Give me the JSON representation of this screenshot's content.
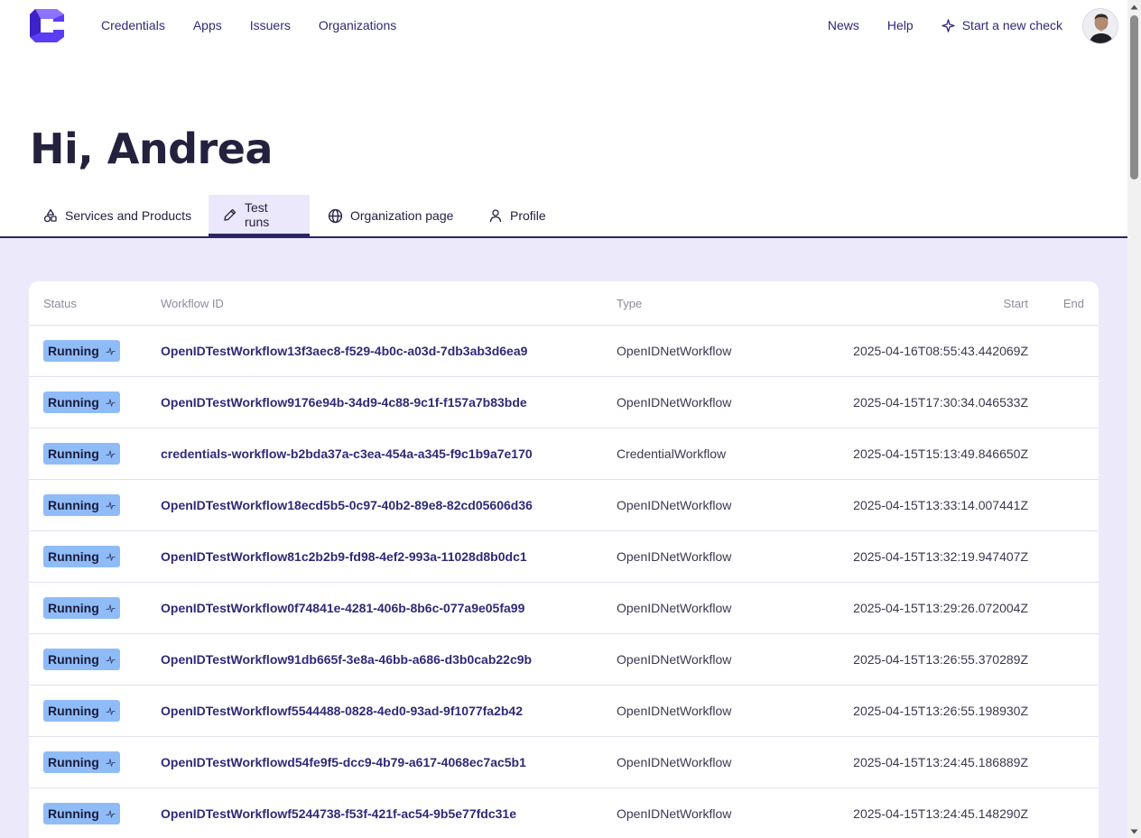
{
  "nav": {
    "links": [
      "Credentials",
      "Apps",
      "Issuers",
      "Organizations"
    ],
    "news": "News",
    "help": "Help",
    "start_check": "Start a new check"
  },
  "greeting": "Hi, Andrea",
  "tabs": [
    {
      "label": "Services and Products",
      "icon": "shapes-icon",
      "active": false
    },
    {
      "label": "Test runs",
      "icon": "pencil-icon",
      "active": true
    },
    {
      "label": "Organization page",
      "icon": "globe-icon",
      "active": false
    },
    {
      "label": "Profile",
      "icon": "user-icon",
      "active": false
    }
  ],
  "table": {
    "headers": {
      "status": "Status",
      "workflow_id": "Workflow ID",
      "type": "Type",
      "start": "Start",
      "end": "End"
    },
    "rows": [
      {
        "status": "Running",
        "id": "OpenIDTestWorkflow13f3aec8-f529-4b0c-a03d-7db3ab3d6ea9",
        "type": "OpenIDNetWorkflow",
        "start": "2025-04-16T08:55:43.442069Z",
        "end": ""
      },
      {
        "status": "Running",
        "id": "OpenIDTestWorkflow9176e94b-34d9-4c88-9c1f-f157a7b83bde",
        "type": "OpenIDNetWorkflow",
        "start": "2025-04-15T17:30:34.046533Z",
        "end": ""
      },
      {
        "status": "Running",
        "id": "credentials-workflow-b2bda37a-c3ea-454a-a345-f9c1b9a7e170",
        "type": "CredentialWorkflow",
        "start": "2025-04-15T15:13:49.846650Z",
        "end": ""
      },
      {
        "status": "Running",
        "id": "OpenIDTestWorkflow18ecd5b5-0c97-40b2-89e8-82cd05606d36",
        "type": "OpenIDNetWorkflow",
        "start": "2025-04-15T13:33:14.007441Z",
        "end": ""
      },
      {
        "status": "Running",
        "id": "OpenIDTestWorkflow81c2b2b9-fd98-4ef2-993a-11028d8b0dc1",
        "type": "OpenIDNetWorkflow",
        "start": "2025-04-15T13:32:19.947407Z",
        "end": ""
      },
      {
        "status": "Running",
        "id": "OpenIDTestWorkflow0f74841e-4281-406b-8b6c-077a9e05fa99",
        "type": "OpenIDNetWorkflow",
        "start": "2025-04-15T13:29:26.072004Z",
        "end": ""
      },
      {
        "status": "Running",
        "id": "OpenIDTestWorkflow91db665f-3e8a-46bb-a686-d3b0cab22c9b",
        "type": "OpenIDNetWorkflow",
        "start": "2025-04-15T13:26:55.370289Z",
        "end": ""
      },
      {
        "status": "Running",
        "id": "OpenIDTestWorkflowf5544488-0828-4ed0-93ad-9f1077fa2b42",
        "type": "OpenIDNetWorkflow",
        "start": "2025-04-15T13:26:55.198930Z",
        "end": ""
      },
      {
        "status": "Running",
        "id": "OpenIDTestWorkflowd54fe9f5-dcc9-4b79-a617-4068ec7ac5b1",
        "type": "OpenIDNetWorkflow",
        "start": "2025-04-15T13:24:45.186889Z",
        "end": ""
      },
      {
        "status": "Running",
        "id": "OpenIDTestWorkflowf5244738-f53f-421f-ac54-9b5e77fdc31e",
        "type": "OpenIDNetWorkflow",
        "start": "2025-04-15T13:24:45.148290Z",
        "end": ""
      }
    ]
  },
  "colors": {
    "brand": "#5b3df5",
    "nav_text": "#2e2a78",
    "content_bg": "#ece9fb",
    "running_badge": "#8fbcf7"
  }
}
